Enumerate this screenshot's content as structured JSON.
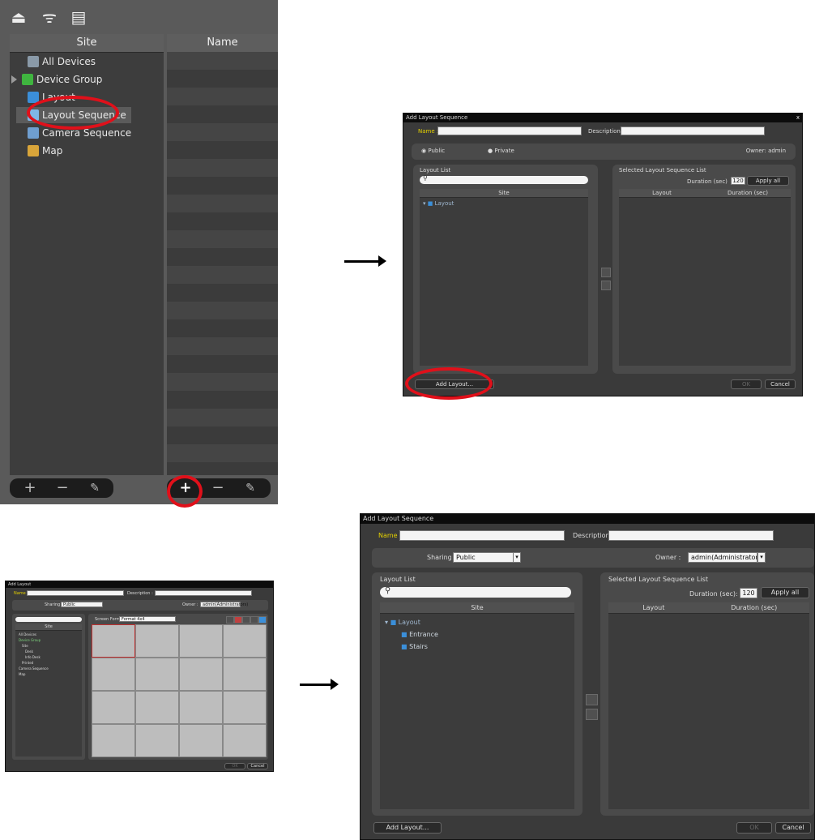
{
  "site_panel": {
    "header_site": "Site",
    "header_name": "Name",
    "tree": [
      {
        "label": "All Devices",
        "icon": "all-devices-icon"
      },
      {
        "label": "Device Group",
        "icon": "device-group-icon"
      },
      {
        "label": "Layout",
        "icon": "layout-icon"
      },
      {
        "label": "Layout Sequence",
        "icon": "layout-sequence-icon"
      },
      {
        "label": "Camera Sequence",
        "icon": "camera-sequence-icon"
      },
      {
        "label": "Map",
        "icon": "map-icon"
      }
    ],
    "bottom_left": [
      "+",
      "−",
      "✎"
    ],
    "bottom_right": [
      "+",
      "−",
      "✎"
    ]
  },
  "dialog_small": {
    "title": "Add Layout Sequence",
    "close": "x",
    "name_label": "Name :",
    "description_label": "Description :",
    "public_label": "Public",
    "private_label": "Private",
    "owner_text": "Owner: admin",
    "layout_list_label": "Layout List",
    "site_header": "Site",
    "tree_root": "Layout",
    "selected_list_label": "Selected Layout Sequence List",
    "duration_label": "Duration (sec)",
    "duration_value": "120",
    "apply_all": "Apply all",
    "col_layout": "Layout",
    "col_duration": "Duration (sec)",
    "add_layout": "Add Layout...",
    "ok": "OK",
    "cancel": "Cancel"
  },
  "dialog_add_layout": {
    "title": "Add Layout",
    "name_label": "Name :",
    "description_label": "Description :",
    "sharing_label": "Sharing :",
    "sharing_value": "Public",
    "owner_label": "Owner :",
    "owner_value": "admin(Administrators)",
    "screen_format_label": "Screen Format :",
    "screen_format_value": "Format 4x4",
    "site_header": "Site",
    "tree": [
      "All Devices",
      "Device Group",
      "Site",
      "Desk",
      "Info Desk",
      "Printed",
      "Camera Sequence",
      "Map"
    ],
    "ok": "OK",
    "cancel": "Cancel"
  },
  "dialog_large": {
    "title": "Add Layout Sequence",
    "name_label": "Name :",
    "description_label": "Description :",
    "sharing_label": "Sharing :",
    "sharing_value": "Public",
    "owner_label": "Owner :",
    "owner_value": "admin(Administrators)",
    "layout_list_label": "Layout List",
    "site_header": "Site",
    "tree_root": "Layout",
    "tree_children": [
      "Entrance",
      "Stairs"
    ],
    "selected_list_label": "Selected Layout Sequence List",
    "duration_label": "Duration (sec):",
    "duration_value": "120",
    "apply_all": "Apply all",
    "col_layout": "Layout",
    "col_duration": "Duration (sec)",
    "add_layout": "Add Layout...",
    "ok": "OK",
    "cancel": "Cancel"
  },
  "colors": {
    "highlight": "#e0101a",
    "label_yellow": "#e4d000",
    "panel_bg": "#3a3a3a"
  }
}
